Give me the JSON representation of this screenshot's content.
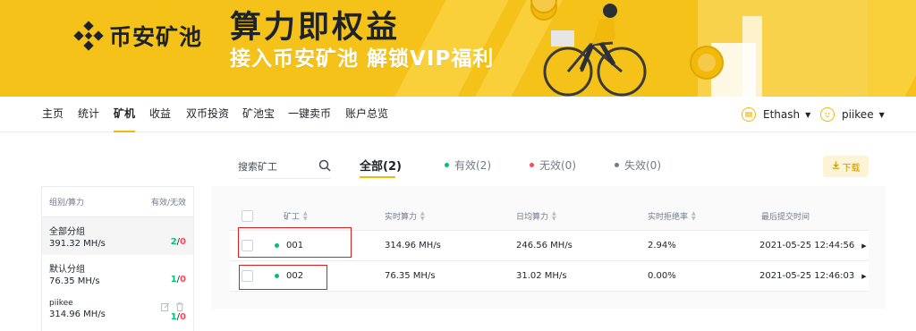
{
  "banner": {
    "logo_text": "币安矿池",
    "title": "算力即权益",
    "subtitle": "接入币安矿池 解锁VIP福利"
  },
  "nav": {
    "items": [
      {
        "label": "主页"
      },
      {
        "label": "统计"
      },
      {
        "label": "矿机",
        "active": true
      },
      {
        "label": "收益"
      },
      {
        "label": "双币投资"
      },
      {
        "label": "矿池宝"
      },
      {
        "label": "一键卖币"
      },
      {
        "label": "账户总览"
      }
    ],
    "coin": "Ethash",
    "user": "piikee"
  },
  "filters": {
    "search_placeholder": "搜索矿工",
    "all": "全部(2)",
    "valid": "有效(2)",
    "invalid": "无效(0)",
    "inactive": "失效(0)",
    "download": "下载"
  },
  "groups": {
    "header_left": "组别/算力",
    "header_right": "有效/无效",
    "items": [
      {
        "name": "全部分组",
        "rate": "391.32 MH/s",
        "valid": "2",
        "sep": "/",
        "invalid": "0"
      },
      {
        "name": "默认分组",
        "rate": "76.35 MH/s",
        "valid": "1",
        "sep": "/",
        "invalid": "0"
      },
      {
        "name": "piikee",
        "rate": "314.96 MH/s",
        "valid": "1",
        "sep": "/",
        "invalid": "0"
      }
    ]
  },
  "table": {
    "headers": {
      "worker": "矿工",
      "realtime": "实时算力",
      "daily": "日均算力",
      "reject": "实时拒绝率",
      "last_submit": "最后提交时间"
    },
    "rows": [
      {
        "worker": "001",
        "realtime": "314.96 MH/s",
        "daily": "246.56 MH/s",
        "reject": "2.94%",
        "last_submit": "2021-05-25 12:44:56"
      },
      {
        "worker": "002",
        "realtime": "76.35 MH/s",
        "daily": "31.02 MH/s",
        "reject": "0.00%",
        "last_submit": "2021-05-25 12:46:03"
      }
    ]
  },
  "colors": {
    "brand_yellow": "#f0b90b",
    "valid_green": "#02c076",
    "invalid_red": "#f84960",
    "highlight_red": "#e02020"
  }
}
